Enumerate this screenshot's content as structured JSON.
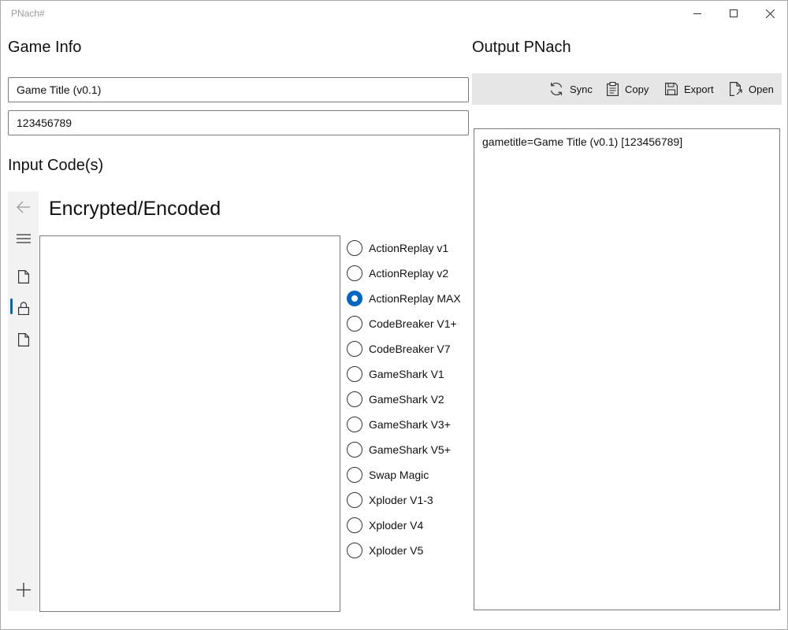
{
  "window": {
    "title": "PNach#"
  },
  "game_info": {
    "heading": "Game Info",
    "title_value": "Game Title (v0.1)",
    "crc_value": "123456789"
  },
  "input": {
    "heading": "Input Code(s)",
    "page_title": "Encrypted/Encoded",
    "code_text": "",
    "nav_icons": [
      "back-arrow-icon",
      "hamburger-menu-icon",
      "document-icon",
      "lock-icon",
      "document-icon",
      "add-icon"
    ],
    "selected_nav": "lock-icon"
  },
  "formats": {
    "options": [
      "ActionReplay v1",
      "ActionReplay v2",
      "ActionReplay MAX",
      "CodeBreaker V1+",
      "CodeBreaker V7",
      "GameShark V1",
      "GameShark V2",
      "GameShark V3+",
      "GameShark V5+",
      "Swap Magic",
      "Xploder V1-3",
      "Xploder V4",
      "Xploder V5"
    ],
    "selected": "ActionReplay MAX"
  },
  "output": {
    "heading": "Output PNach",
    "toolbar": {
      "sync_label": "Sync",
      "copy_label": "Copy",
      "export_label": "Export",
      "open_label": "Open"
    },
    "text": "gametitle=Game Title (v0.1) [123456789]"
  },
  "colors": {
    "accent": "#0067c0",
    "toolbar_bg": "#e6e6e6",
    "nav_bg": "#f2f2f2"
  }
}
